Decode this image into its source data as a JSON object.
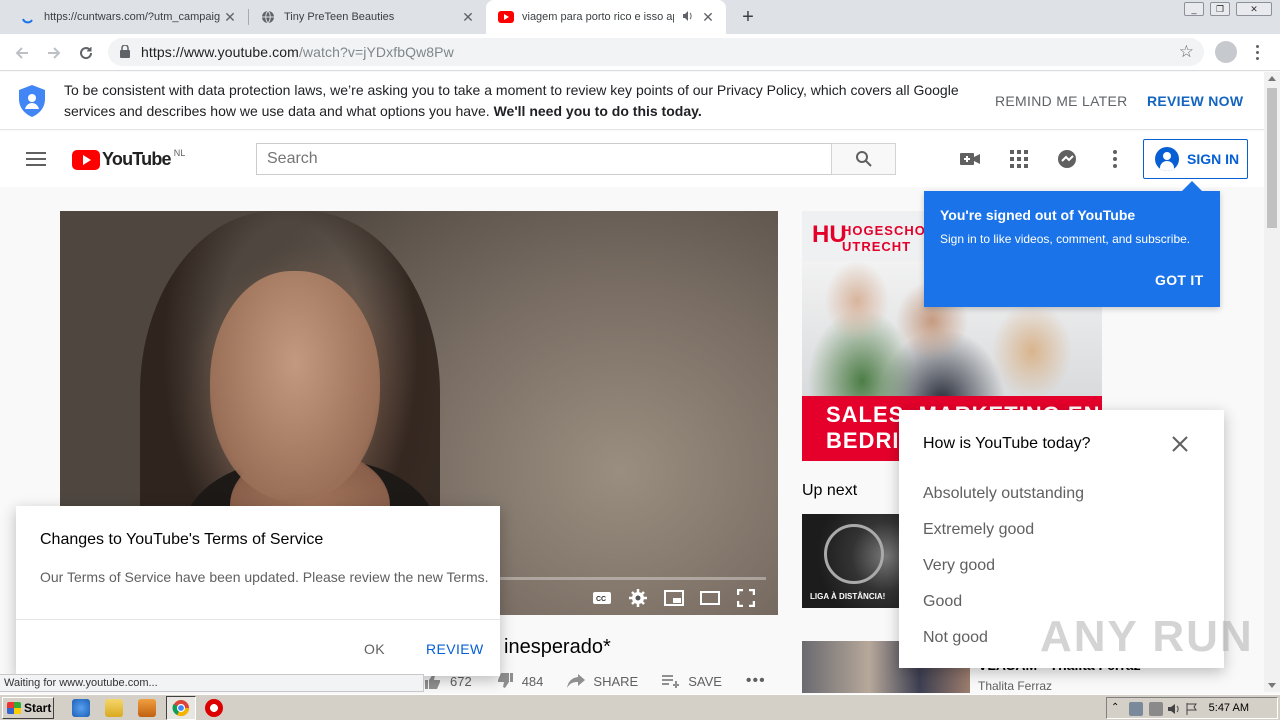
{
  "browser": {
    "tabs": [
      {
        "title": "https://cuntwars.com/?utm_campaig",
        "active": false
      },
      {
        "title": "Tiny PreTeen Beauties",
        "active": false
      },
      {
        "title": "viagem para porto rico e isso ap",
        "active": true
      }
    ],
    "new_tab_symbol": "+",
    "url_host": "https://www.youtube.com",
    "url_path": "/watch?v=jYDxfbQw8Pw",
    "window_controls": [
      "minimize",
      "restore",
      "close"
    ]
  },
  "privacy_banner": {
    "message": "To be consistent with data protection laws, we’re asking you to take a moment to review key points of our Privacy Policy, which covers all Google services and describes how we use data and what options you have.",
    "message_bold": "We'll need you to do this today.",
    "remind_label": "REMIND ME LATER",
    "review_label": "REVIEW NOW"
  },
  "masthead": {
    "logo_text": "YouTube",
    "country_code": "NL",
    "search_placeholder": "Search",
    "signin_label": "SIGN IN"
  },
  "signed_out_tooltip": {
    "title": "You're signed out of YouTube",
    "subtitle": "Sign in to like videos, comment, and subscribe.",
    "button": "GOT IT"
  },
  "ad": {
    "logo_mark": "HU",
    "name_line1": "HOGESCHOOL",
    "name_line2": "UTRECHT",
    "band_line1": "SALES, MARKETING EN",
    "band_line2": "BEDRIJF"
  },
  "up_next": {
    "label": "Up next",
    "items": [
      {
        "thumb_caption": "LIGA À DISTÂNCIA!"
      },
      {
        "title": "VLASAM - Thalita Ferraz",
        "channel": "Thalita Ferraz"
      }
    ]
  },
  "video": {
    "title_visible": "l inesperado*",
    "likes": "672",
    "dislikes": "484",
    "share_label": "SHARE",
    "save_label": "SAVE",
    "more_label": "•••"
  },
  "survey": {
    "question": "How is YouTube today?",
    "options": [
      "Absolutely outstanding",
      "Extremely good",
      "Very good",
      "Good",
      "Not good"
    ]
  },
  "tos_dialog": {
    "title": "Changes to YouTube's Terms of Service",
    "body": "Our Terms of Service have been updated. Please review the new Terms.",
    "ok_label": "OK",
    "review_label": "REVIEW"
  },
  "status_text": "Waiting for www.youtube.com...",
  "watermark": "ANY RUN",
  "taskbar": {
    "start_label": "Start",
    "clock": "5:47 AM",
    "quick_launch": [
      "ie-icon",
      "folder-icon",
      "media-player-icon",
      "chrome-icon",
      "opera-icon"
    ]
  },
  "colors": {
    "yt_red": "#ff0000",
    "yt_blue": "#065fd4",
    "tooltip_blue": "#1a73e8",
    "ad_red": "#e4002b"
  }
}
